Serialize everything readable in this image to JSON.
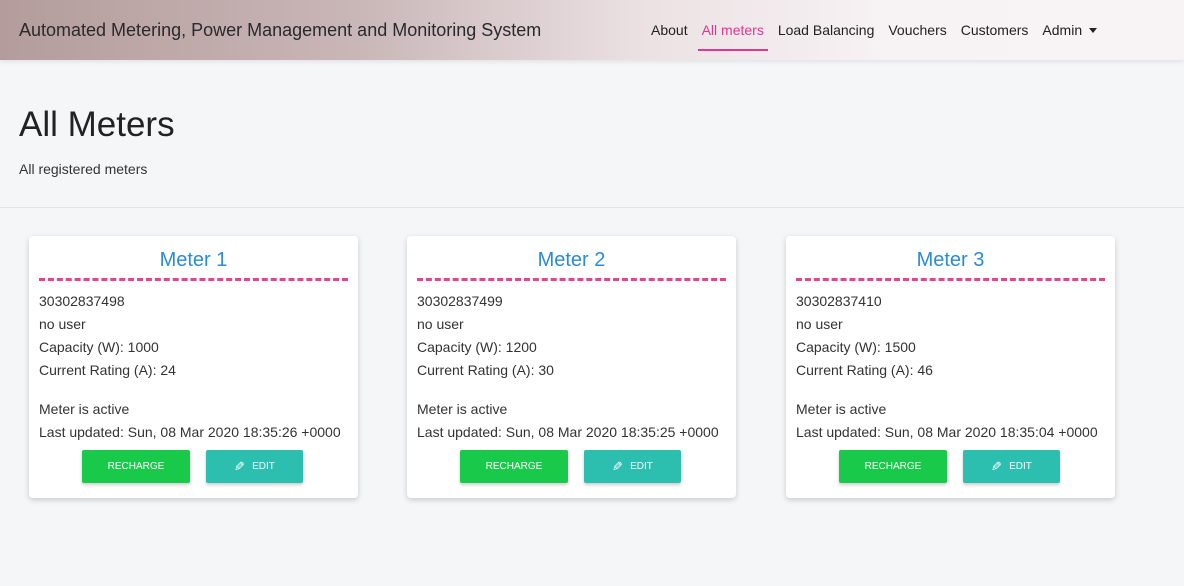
{
  "app": {
    "brand": "Automated Metering, Power Management and Monitoring System"
  },
  "nav": {
    "items": [
      {
        "label": "About"
      },
      {
        "label": "All meters"
      },
      {
        "label": "Load Balancing"
      },
      {
        "label": "Vouchers"
      },
      {
        "label": "Customers"
      },
      {
        "label": "Admin"
      }
    ],
    "active": "All meters"
  },
  "page": {
    "title": "All Meters",
    "subtitle": "All registered meters"
  },
  "meters": [
    {
      "title": "Meter 1",
      "number": "30302837498",
      "user": "no user",
      "capacity": "Capacity (W): 1000",
      "current": "Current Rating (A): 24",
      "status": "Meter is active",
      "updated": "Last updated: Sun, 08 Mar 2020 18:35:26 +0000",
      "recharge_label": "RECHARGE",
      "edit_label": "EDIT"
    },
    {
      "title": "Meter 2",
      "number": "30302837499",
      "user": "no user",
      "capacity": "Capacity (W): 1200",
      "current": "Current Rating (A): 30",
      "status": "Meter is active",
      "updated": "Last updated: Sun, 08 Mar 2020 18:35:25 +0000",
      "recharge_label": "RECHARGE",
      "edit_label": "EDIT"
    },
    {
      "title": "Meter 3",
      "number": "30302837410",
      "user": "no user",
      "capacity": "Capacity (W): 1500",
      "current": "Current Rating (A): 46",
      "status": "Meter is active",
      "updated": "Last updated: Sun, 08 Mar 2020 18:35:04 +0000",
      "recharge_label": "RECHARGE",
      "edit_label": "EDIT"
    }
  ],
  "colors": {
    "accent": "#e0378f",
    "card_title": "#2a8bd8",
    "recharge_button": "#19c94a",
    "edit_button": "#2cbfb0"
  },
  "icons": {
    "edit": "pencil-icon",
    "dropdown": "caret-down-icon"
  }
}
